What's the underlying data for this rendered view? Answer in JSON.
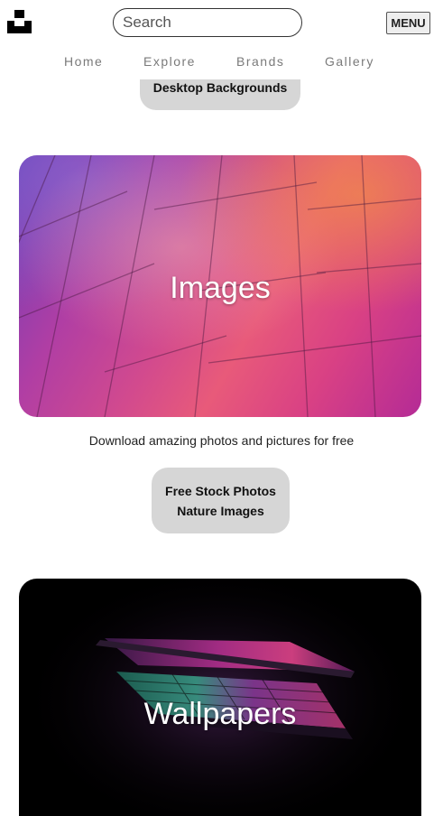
{
  "header": {
    "search_placeholder": "Search",
    "menu_label": "MENU",
    "nav": [
      "Home",
      "Explore",
      "Brands",
      "Gallery"
    ]
  },
  "previous_section": {
    "links": [
      "Desktop Backgrounds"
    ]
  },
  "images_section": {
    "title": "Images",
    "description": "Download amazing photos and pictures for free",
    "links": [
      "Free Stock Photos",
      "Nature Images"
    ]
  },
  "wallpapers_section": {
    "title": "Wallpapers"
  },
  "colors": {
    "pill_background": "#d6d6d6",
    "nav_text": "#7a7a7a",
    "images_gradient": [
      "#6b3fb8",
      "#b03ea4",
      "#e85a7a",
      "#b42b96"
    ],
    "wallpapers_background": "#000000"
  },
  "icons": {
    "logo": "unsplash-logo-icon"
  }
}
